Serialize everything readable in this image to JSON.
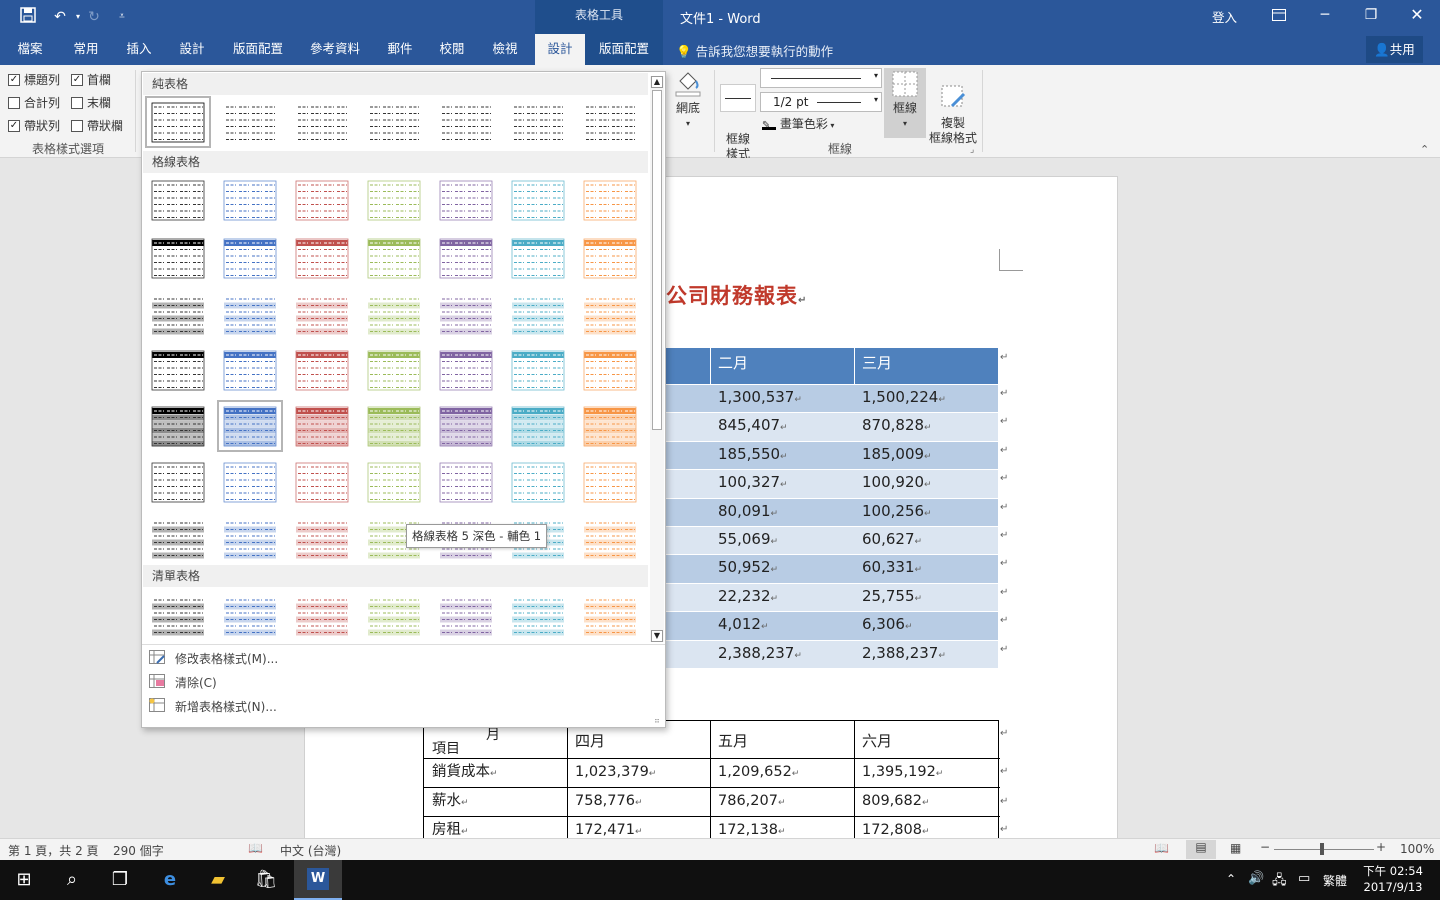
{
  "window": {
    "context_tab_group": "表格工具",
    "title": "文件1 - Word",
    "signin": "登入",
    "share": "共用",
    "tell_me": "告訴我您想要執行的動作"
  },
  "ribbon_tabs": [
    "檔案",
    "常用",
    "插入",
    "設計",
    "版面配置",
    "參考資料",
    "郵件",
    "校閱",
    "檢視",
    "設計",
    "版面配置"
  ],
  "ribbon": {
    "style_options": {
      "header_row": "標題列",
      "header_row_checked": true,
      "first_col": "首欄",
      "first_col_checked": true,
      "total_row": "合計列",
      "total_row_checked": false,
      "last_col": "末欄",
      "last_col_checked": false,
      "banded_rows": "帶狀列",
      "banded_rows_checked": true,
      "banded_cols": "帶狀欄",
      "banded_cols_checked": false,
      "group_label": "表格樣式選項"
    },
    "shading": "網底",
    "border_styles": "框線\n樣式",
    "pen_weight": "1/2 pt",
    "pen_color": "畫筆色彩",
    "borders": "框線",
    "border_painter": "複製\n框線格式",
    "borders_group_label": "框線"
  },
  "gallery": {
    "sections": [
      "純表格",
      "格線表格",
      "清單表格"
    ],
    "tooltip": "格線表格 5 深色 - 輔色 1",
    "accent_colors": [
      "#000000",
      "#4472c4",
      "#c0504d",
      "#9bbb59",
      "#8064a2",
      "#4bacc6",
      "#f79646"
    ],
    "commands": [
      "修改表格樣式(M)...",
      "清除(C)",
      "新增表格樣式(N)..."
    ]
  },
  "document": {
    "title_fragment": "公司財務報表",
    "table1": {
      "headers": [
        "二月",
        "三月"
      ],
      "rows": [
        [
          "1,300,537",
          "1,500,224"
        ],
        [
          "845,407",
          "870,828"
        ],
        [
          "185,550",
          "185,009"
        ],
        [
          "100,327",
          "100,920"
        ],
        [
          "80,091",
          "100,256"
        ],
        [
          "55,069",
          "60,627"
        ],
        [
          "50,952",
          "60,331"
        ],
        [
          "22,232",
          "25,755"
        ],
        [
          "4,012",
          "6,306"
        ],
        [
          "2,388,237",
          "2,388,237"
        ]
      ]
    },
    "table2": {
      "header_corner_top": "月",
      "header_corner_bottom": "項目",
      "headers": [
        "四月",
        "五月",
        "六月"
      ],
      "rows": [
        [
          "銷貨成本",
          "1,023,379",
          "1,209,652",
          "1,395,192"
        ],
        [
          "薪水",
          "758,776",
          "786,207",
          "809,682"
        ],
        [
          "房租",
          "172,471",
          "172,138",
          "172,808"
        ]
      ]
    }
  },
  "statusbar": {
    "page": "第 1 頁，共 2 頁",
    "words": "290 個字",
    "language": "中文 (台灣)",
    "zoom": "100%"
  },
  "taskbar": {
    "ime": "繁體",
    "time": "下午 02:54",
    "date": "2017/9/13"
  }
}
